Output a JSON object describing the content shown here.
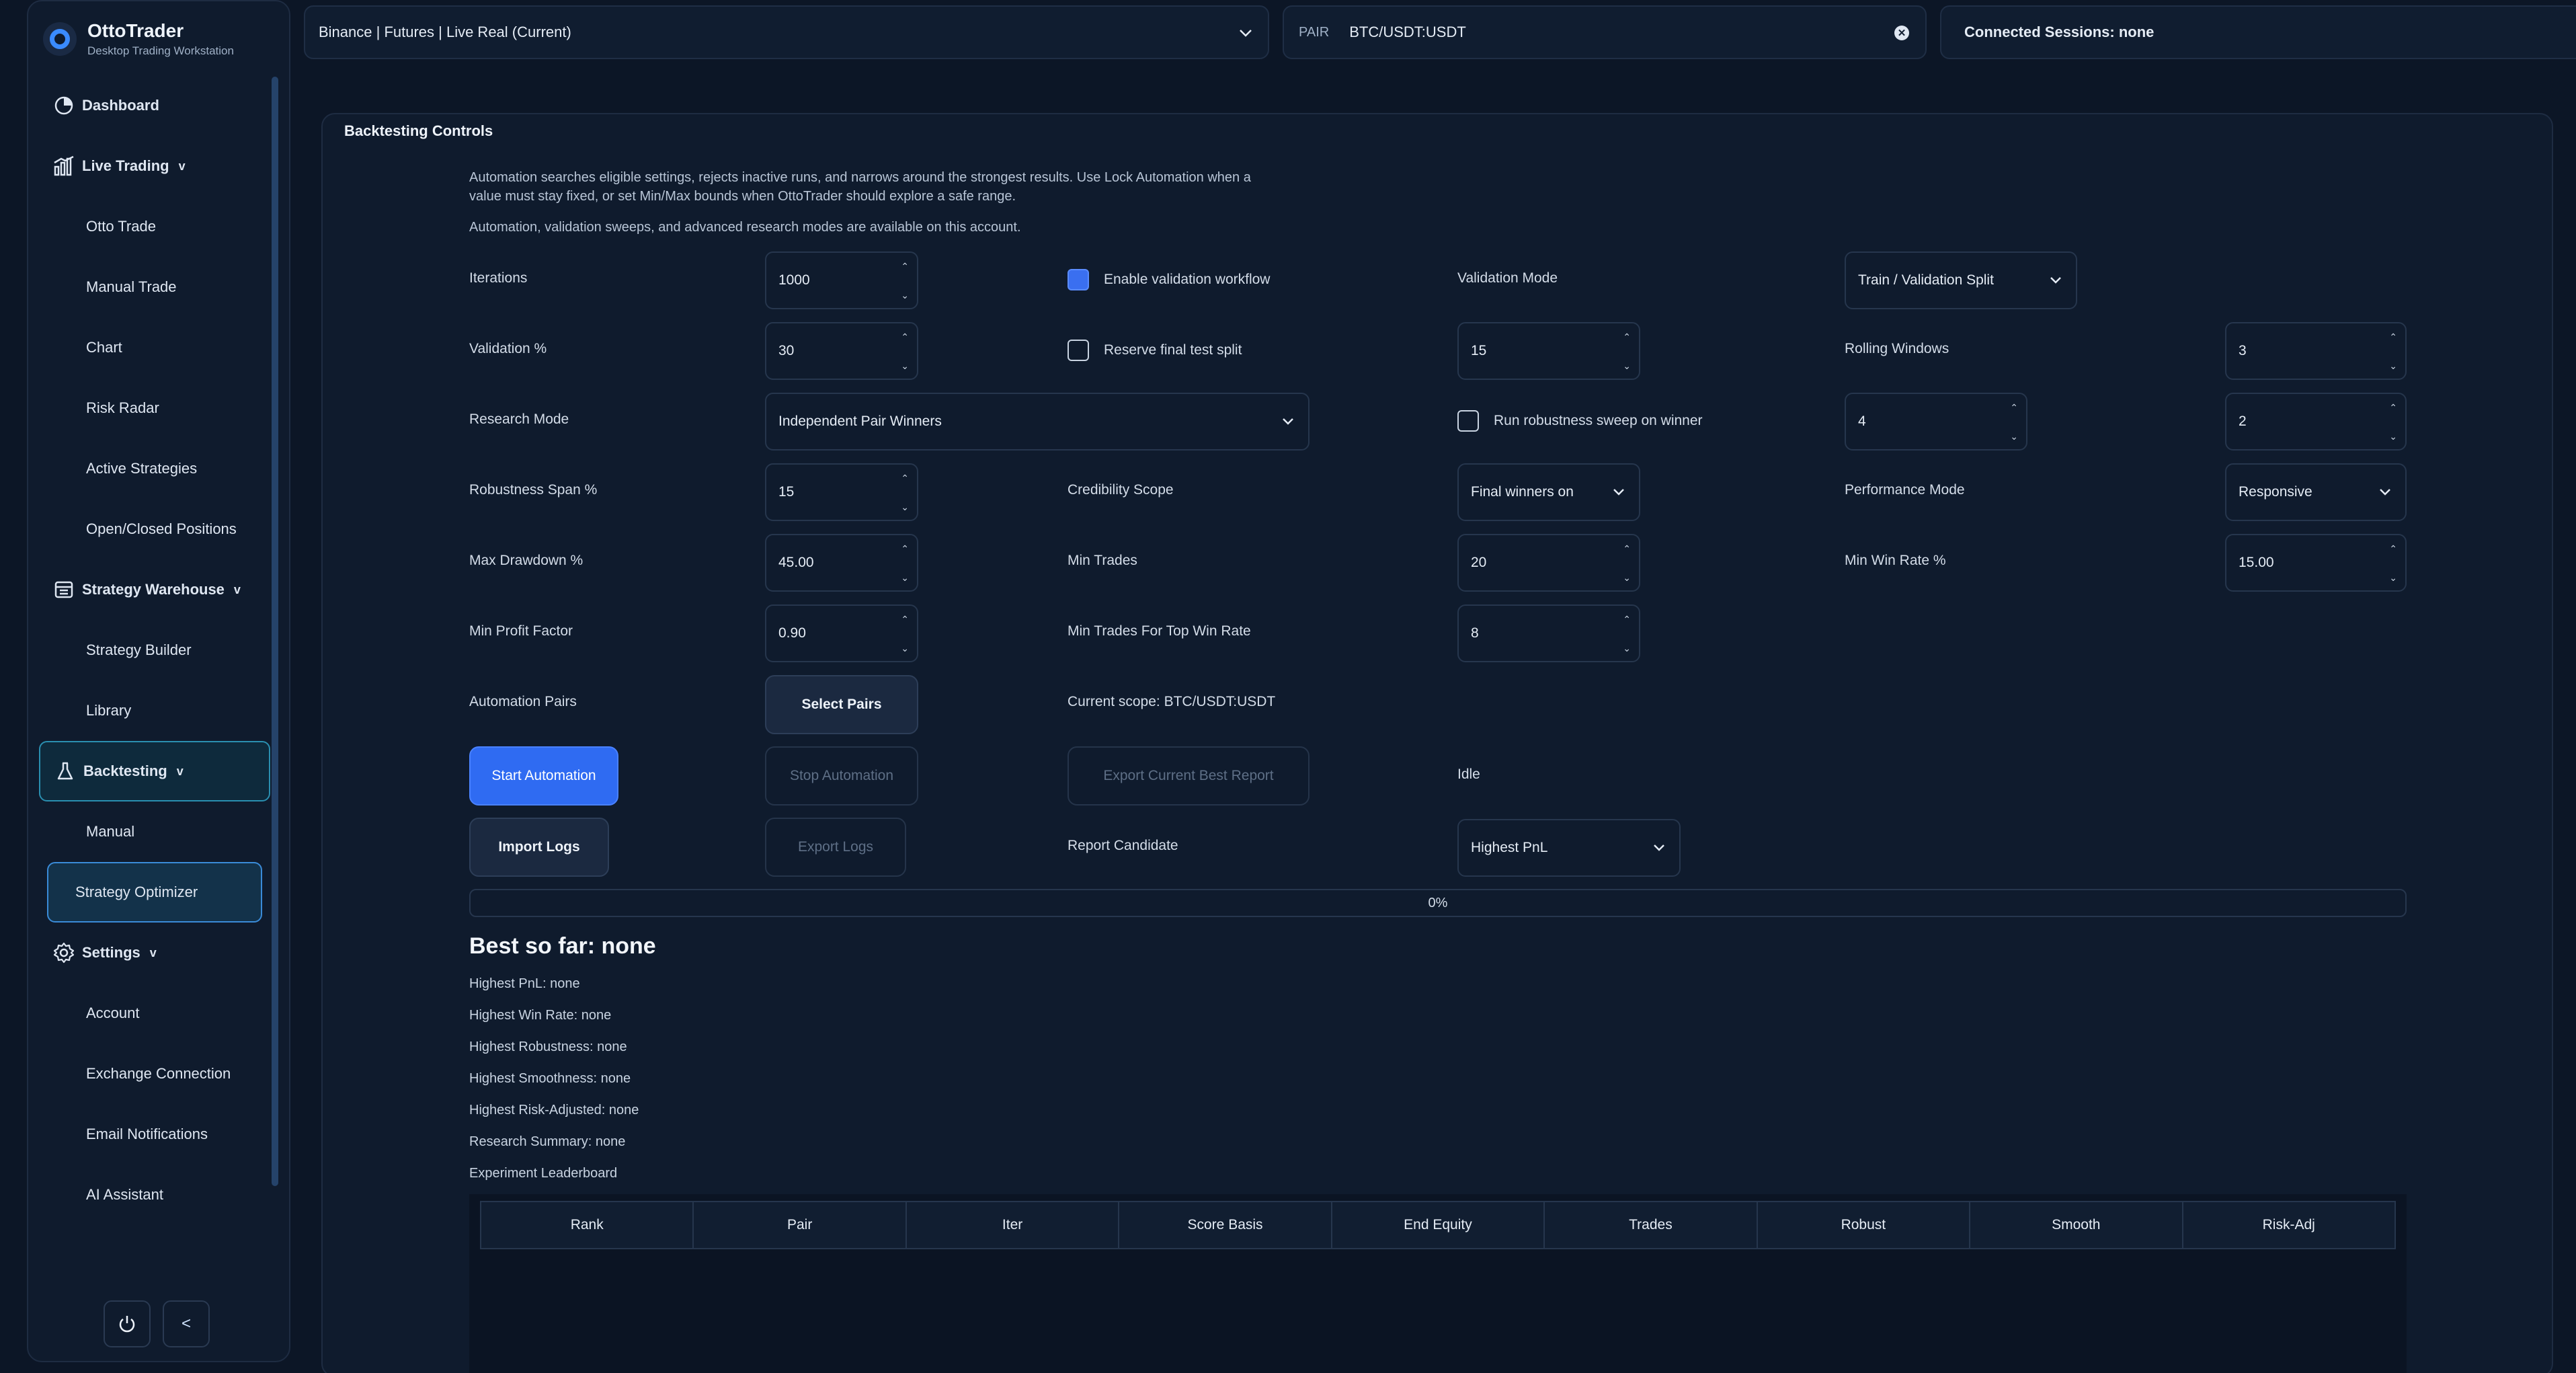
{
  "brand": {
    "title": "OttoTrader",
    "subtitle": "Desktop Trading Workstation"
  },
  "sidebar": {
    "dashboard": "Dashboard",
    "live_trading": "Live Trading",
    "live_items": [
      "Otto Trade",
      "Manual Trade",
      "Chart",
      "Risk Radar",
      "Active Strategies",
      "Open/Closed Positions"
    ],
    "warehouse": "Strategy Warehouse",
    "warehouse_items": [
      "Strategy Builder",
      "Library"
    ],
    "backtesting": "Backtesting",
    "backtesting_items": [
      "Manual",
      "Strategy Optimizer"
    ],
    "settings": "Settings",
    "settings_items": [
      "Account",
      "Exchange Connection",
      "Email Notifications",
      "AI Assistant"
    ],
    "caret": "v",
    "collapse": "<"
  },
  "topbar": {
    "exchange": "Binance | Futures | Live Real (Current)",
    "pair_label": "PAIR",
    "pair_value": "BTC/USDT:USDT",
    "sessions": "Connected Sessions: none"
  },
  "panel": {
    "title": "Backtesting Controls",
    "desc1": "Automation searches eligible settings, rejects inactive runs, and narrows around the strongest results. Use Lock Automation when a value must stay fixed, or set Min/Max bounds when OttoTrader should explore a safe range.",
    "desc2": "Automation, validation sweeps, and advanced research modes are available on this account.",
    "iterations_label": "Iterations",
    "iterations": "1000",
    "enable_validation": "Enable validation workflow",
    "validation_mode_label": "Validation Mode",
    "validation_mode": "Train / Validation Split",
    "validation_pct_label": "Validation %",
    "validation_pct": "30",
    "reserve_test": "Reserve final test split",
    "reserve_value": "15",
    "rolling_windows_label": "Rolling Windows",
    "rolling_windows": "3",
    "research_mode_label": "Research Mode",
    "research_mode": "Independent Pair Winners",
    "robustness_sweep": "Run robustness sweep on winner",
    "sweep_a": "4",
    "sweep_b": "2",
    "robustness_span_label": "Robustness Span %",
    "robustness_span": "15",
    "credibility_label": "Credibility Scope",
    "credibility": "Final winners on",
    "performance_label": "Performance Mode",
    "performance": "Responsive",
    "max_dd_label": "Max Drawdown %",
    "max_dd": "45.00",
    "min_trades_label": "Min Trades",
    "min_trades": "20",
    "min_winrate_label": "Min Win Rate %",
    "min_winrate": "15.00",
    "min_pf_label": "Min Profit Factor",
    "min_pf": "0.90",
    "min_trades_top_label": "Min Trades For Top Win Rate",
    "min_trades_top": "8",
    "auto_pairs_label": "Automation Pairs",
    "select_pairs": "Select Pairs",
    "current_scope": "Current scope: BTC/USDT:USDT",
    "start": "Start Automation",
    "stop": "Stop Automation",
    "export_best": "Export Current Best Report",
    "status": "Idle",
    "import_logs": "Import Logs",
    "export_logs": "Export Logs",
    "report_candidate_label": "Report Candidate",
    "report_candidate": "Highest PnL",
    "progress_text": "0%",
    "progress_value": 0,
    "best": "Best so far: none",
    "stats": [
      "Highest PnL: none",
      "Highest Win Rate: none",
      "Highest Robustness: none",
      "Highest Smoothness: none",
      "Highest Risk-Adjusted: none",
      "Research Summary: none",
      "Experiment Leaderboard"
    ],
    "columns": [
      "Rank",
      "Pair",
      "Iter",
      "Score Basis",
      "End Equity",
      "Trades",
      "Robust",
      "Smooth",
      "Risk-Adj"
    ]
  },
  "colors": {
    "accent": "#2f6bf2",
    "background": "#0c1626"
  }
}
